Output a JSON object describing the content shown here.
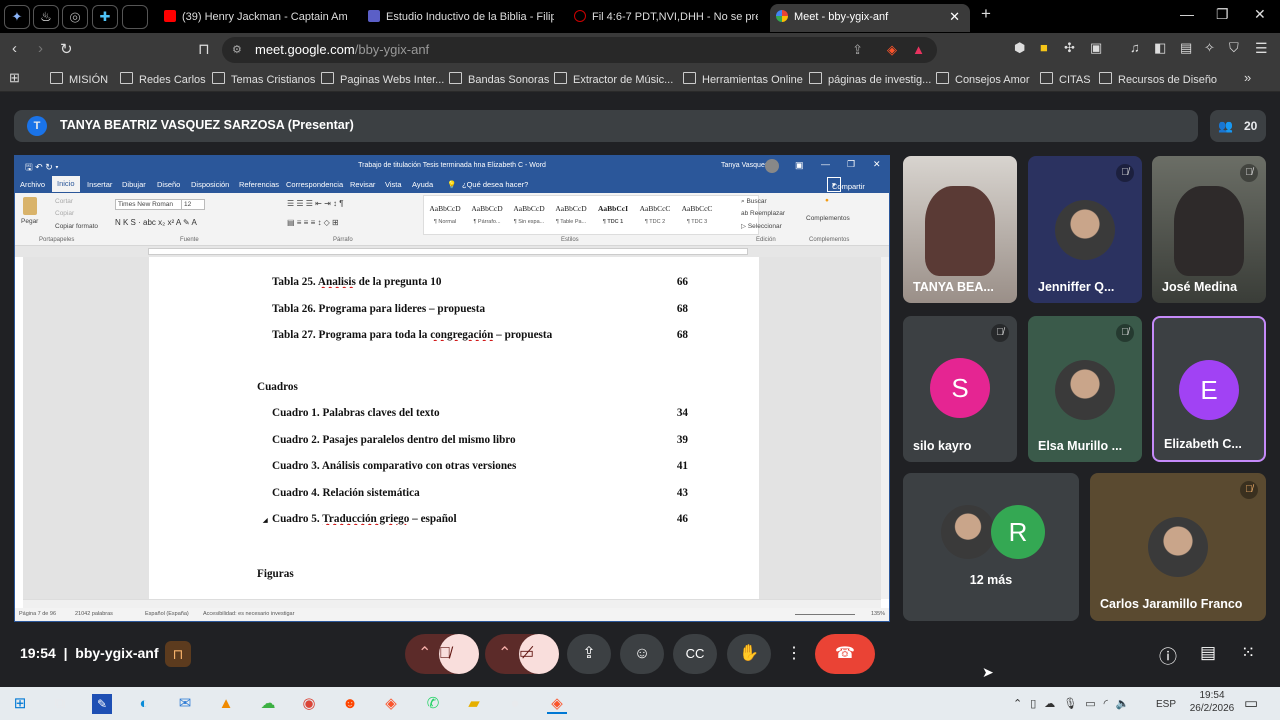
{
  "browser": {
    "tabs": [
      {
        "title": "(39) Henry Jackman - Captain Americ",
        "icon": "youtube-icon",
        "color": "#ff0000"
      },
      {
        "title": "Estudio Inductivo de la Biblia - Filiper",
        "icon": "forms-icon",
        "color": "#5b5fc7"
      },
      {
        "title": "Fil 4:6-7 PDT,NVI,DHH - No se preoc",
        "icon": "bible-icon",
        "color": "#c00000"
      },
      {
        "title": "Meet - bby-ygix-anf",
        "icon": "meet-icon",
        "color": "#34a853"
      }
    ],
    "url_host": "meet.google.com",
    "url_path": "/bby-ygix-anf",
    "bookmarks": [
      "MISIÓN",
      "Redes Carlos",
      "Temas Cristianos",
      "Paginas Webs Inter...",
      "Bandas Sonoras",
      "Extractor de Músic...",
      "Herramientas Online",
      "páginas de investig...",
      "Consejos Amor",
      "CITAS",
      "Recursos de Diseño"
    ]
  },
  "meet": {
    "presenter_initial": "T",
    "presenter": "TANYA BEATRIZ VASQUEZ SARZOSA (Presentar)",
    "participant_count": "20",
    "tiles": [
      {
        "name": "TANYA BEA...",
        "type": "video"
      },
      {
        "name": "Jenniffer Q...",
        "type": "photo",
        "muted": true
      },
      {
        "name": "José Medina",
        "type": "video",
        "muted": true
      },
      {
        "name": "silo kayro",
        "type": "letter",
        "letter": "S",
        "color": "#e52592",
        "muted": true
      },
      {
        "name": "Elsa Murillo ...",
        "type": "photo",
        "muted": true
      },
      {
        "name": "Elizabeth C...",
        "type": "letter",
        "letter": "E",
        "color": "#a142f4",
        "speaking": true
      },
      {
        "name": "12 más",
        "type": "more",
        "letter": "R",
        "color": "#34a853"
      },
      {
        "name": "Carlos Jaramillo Franco",
        "type": "photo",
        "muted": true
      }
    ],
    "time": "19:54",
    "code": "bby-ygix-anf"
  },
  "word": {
    "title": "Trabajo de titulación Tesis terminada hna Elizabeth C  -  Word",
    "user": "Tanya Vasquez",
    "menu": [
      "Archivo",
      "Inicio",
      "Insertar",
      "Dibujar",
      "Diseño",
      "Disposición",
      "Referencias",
      "Correspondencia",
      "Revisar",
      "Vista",
      "Ayuda",
      "¿Qué desea hacer?"
    ],
    "share": "Compartir",
    "clipboard": {
      "paste": "Pegar",
      "cut": "Cortar",
      "copy": "Copiar",
      "format": "Copiar formato",
      "group": "Portapapeles"
    },
    "font": {
      "name": "Times New Roman",
      "size": "12",
      "group": "Fuente"
    },
    "paragraph_group": "Párrafo",
    "styles": [
      {
        "s": "AaBbCcD",
        "n": "¶ Normal"
      },
      {
        "s": "AaBbCcD",
        "n": "¶ Párrafo..."
      },
      {
        "s": "AaBbCcD",
        "n": "¶ Sin espa..."
      },
      {
        "s": "AaBbCcD",
        "n": "¶ Table Pa..."
      },
      {
        "s": "AaBbCcI",
        "n": "¶ TDC 1"
      },
      {
        "s": "AaBbCcC",
        "n": "¶ TDC 2"
      },
      {
        "s": "AaBbCcC",
        "n": "¶ TDC 3"
      }
    ],
    "styles_group": "Estilos",
    "edit": {
      "find": "Buscar",
      "replace": "Reemplazar",
      "select": "Seleccionar",
      "group": "Edición"
    },
    "addins": {
      "label": "Complementos",
      "group": "Complementos"
    },
    "doc": {
      "tablas": [
        {
          "pre": "Tabla 25. ",
          "u": "Analisis",
          "post": " de la pregunta 10",
          "page": "66"
        },
        {
          "pre": "Tabla 26. Programa para lideres – propuesta",
          "u": "",
          "post": "",
          "page": "68"
        },
        {
          "pre": "Tabla 27. Programa para toda la ",
          "u": "congregación",
          "post": " – propuesta",
          "page": "68"
        }
      ],
      "cuadros_heading": "Cuadros",
      "cuadros": [
        {
          "pre": "Cuadro 1. Palabras claves del texto",
          "u": "",
          "post": "",
          "page": "34"
        },
        {
          "pre": "Cuadro 2. Pasajes paralelos dentro del mismo libro",
          "u": "",
          "post": "",
          "page": "39"
        },
        {
          "pre": "Cuadro 3. Análisis comparativo con otras versiones",
          "u": "",
          "post": "",
          "page": "41"
        },
        {
          "pre": "Cuadro 4. Relación sistemática",
          "u": "",
          "post": "",
          "page": "43"
        },
        {
          "pre": "Cuadro 5. ",
          "u": "Traducción griego",
          "post": " – español",
          "page": "46"
        }
      ],
      "figuras_heading": "Figuras"
    },
    "status": {
      "page": "Página 7 de 96",
      "words": "21042 palabras",
      "lang": "Español (España)",
      "access": "Accesibilidad: es necesario investigar",
      "zoom": "135%"
    }
  },
  "taskbar": {
    "lang": "ESP",
    "time": "19:54",
    "date": "26/2/2026"
  }
}
